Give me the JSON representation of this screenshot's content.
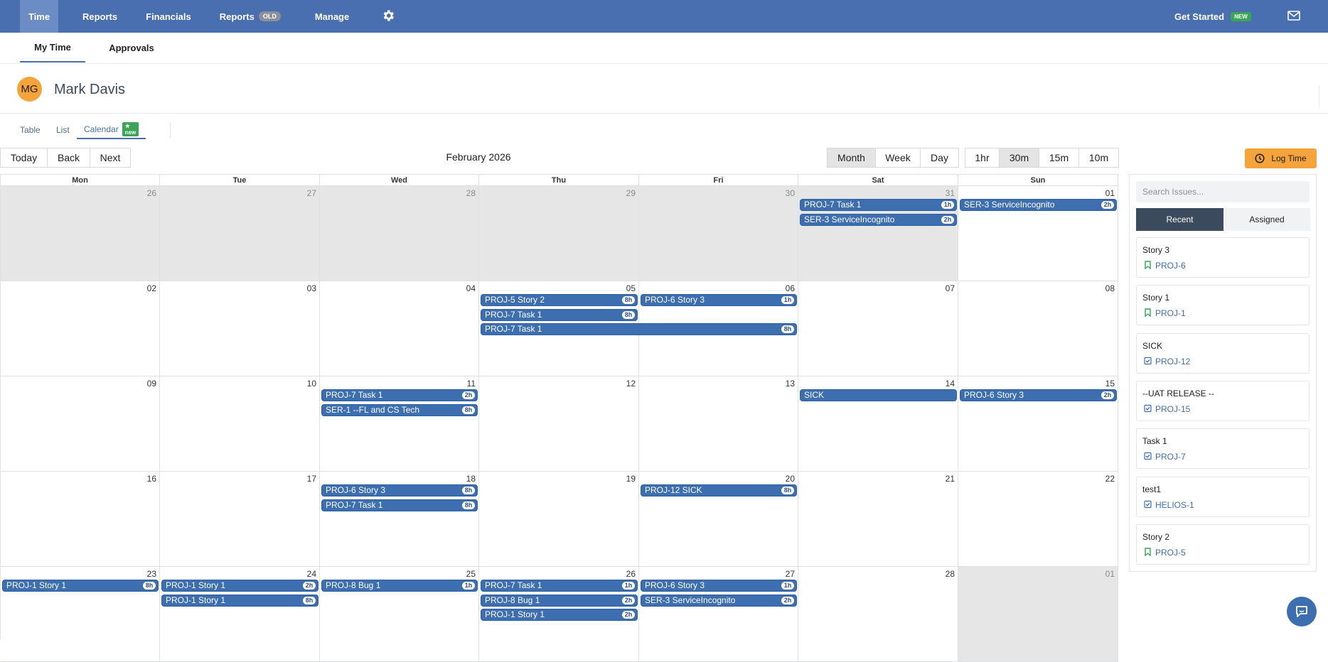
{
  "nav": {
    "items": [
      "Time",
      "Reports",
      "Financials",
      "Reports",
      "Manage"
    ],
    "old_badge": "OLD",
    "get_started": "Get Started",
    "new_badge": "NEW"
  },
  "subtabs": [
    "My Time",
    "Approvals"
  ],
  "user": {
    "initials": "MG",
    "name": "Mark Davis"
  },
  "views": {
    "table": "Table",
    "list": "List",
    "calendar": "Calendar",
    "new_badge": "★ new"
  },
  "toolbar": {
    "today": "Today",
    "back": "Back",
    "next": "Next",
    "title": "February 2026",
    "views": [
      "Month",
      "Week",
      "Day"
    ],
    "selected_view": "Month",
    "steps": [
      "1hr",
      "30m",
      "15m",
      "10m"
    ],
    "selected_step": "30m",
    "log_time": "Log Time"
  },
  "calendar": {
    "day_headers": [
      "Mon",
      "Tue",
      "Wed",
      "Thu",
      "Fri",
      "Sat",
      "Sun"
    ],
    "weeks": [
      [
        "26",
        "27",
        "28",
        "29",
        "30",
        "31",
        "01"
      ],
      [
        "02",
        "03",
        "04",
        "05",
        "06",
        "07",
        "08"
      ],
      [
        "09",
        "10",
        "11",
        "12",
        "13",
        "14",
        "15"
      ],
      [
        "16",
        "17",
        "18",
        "19",
        "20",
        "21",
        "22"
      ],
      [
        "23",
        "24",
        "25",
        "26",
        "27",
        "28",
        "01"
      ]
    ],
    "out_of_month": [
      [
        0,
        0
      ],
      [
        0,
        1
      ],
      [
        0,
        2
      ],
      [
        0,
        3
      ],
      [
        0,
        4
      ],
      [
        0,
        5
      ],
      [
        4,
        6
      ]
    ],
    "events": [
      {
        "label": "PROJ-7 Task 1",
        "hours": "1h",
        "week": 0,
        "day": 5,
        "span": 1,
        "slot": 0
      },
      {
        "label": "SER-3 ServiceIncognito",
        "hours": "2h",
        "week": 0,
        "day": 5,
        "span": 1,
        "slot": 1
      },
      {
        "label": "SER-3 ServiceIncognito",
        "hours": "2h",
        "week": 0,
        "day": 6,
        "span": 1,
        "slot": 0
      },
      {
        "label": "PROJ-5 Story 2",
        "hours": "8h",
        "week": 1,
        "day": 3,
        "span": 1,
        "slot": 0
      },
      {
        "label": "PROJ-7 Task 1",
        "hours": "8h",
        "week": 1,
        "day": 3,
        "span": 1,
        "slot": 1
      },
      {
        "label": "PROJ-7 Task 1",
        "hours": "8h",
        "week": 1,
        "day": 3,
        "span": 2,
        "slot": 2
      },
      {
        "label": "PROJ-6 Story 3",
        "hours": "1h",
        "week": 1,
        "day": 4,
        "span": 1,
        "slot": 0
      },
      {
        "label": "PROJ-7 Task 1",
        "hours": "2h",
        "week": 2,
        "day": 2,
        "span": 1,
        "slot": 0
      },
      {
        "label": "SER-1 --FL and CS Tech",
        "hours": "8h",
        "week": 2,
        "day": 2,
        "span": 1,
        "slot": 1
      },
      {
        "label": "SICK",
        "hours": "",
        "week": 2,
        "day": 5,
        "span": 1,
        "slot": 0
      },
      {
        "label": "PROJ-6 Story 3",
        "hours": "2h",
        "week": 2,
        "day": 6,
        "span": 1,
        "slot": 0
      },
      {
        "label": "PROJ-6 Story 3",
        "hours": "8h",
        "week": 3,
        "day": 2,
        "span": 1,
        "slot": 0
      },
      {
        "label": "PROJ-7 Task 1",
        "hours": "8h",
        "week": 3,
        "day": 2,
        "span": 1,
        "slot": 1
      },
      {
        "label": "PROJ-12 SICK",
        "hours": "8h",
        "week": 3,
        "day": 4,
        "span": 1,
        "slot": 0
      },
      {
        "label": "PROJ-1 Story 1",
        "hours": "8h",
        "week": 4,
        "day": 0,
        "span": 1,
        "slot": 0
      },
      {
        "label": "PROJ-1 Story 1",
        "hours": "2h",
        "week": 4,
        "day": 1,
        "span": 1,
        "slot": 0
      },
      {
        "label": "PROJ-1 Story 1",
        "hours": "8h",
        "week": 4,
        "day": 1,
        "span": 1,
        "slot": 1
      },
      {
        "label": "PROJ-8 Bug 1",
        "hours": "1h",
        "week": 4,
        "day": 2,
        "span": 1,
        "slot": 0
      },
      {
        "label": "PROJ-7 Task 1",
        "hours": "1h",
        "week": 4,
        "day": 3,
        "span": 1,
        "slot": 0
      },
      {
        "label": "PROJ-8 Bug 1",
        "hours": "2h",
        "week": 4,
        "day": 3,
        "span": 1,
        "slot": 1
      },
      {
        "label": "PROJ-1 Story 1",
        "hours": "2h",
        "week": 4,
        "day": 3,
        "span": 1,
        "slot": 2
      },
      {
        "label": "PROJ-6 Story 3",
        "hours": "1h",
        "week": 4,
        "day": 4,
        "span": 1,
        "slot": 0
      },
      {
        "label": "SER-3 ServiceIncognito",
        "hours": "2h",
        "week": 4,
        "day": 4,
        "span": 1,
        "slot": 1
      }
    ]
  },
  "panel": {
    "search_placeholder": "Search Issues...",
    "tabs": [
      "Recent",
      "Assigned"
    ],
    "issues": [
      {
        "title": "Story 3",
        "key": "PROJ-6",
        "icon": "bookmark-icon"
      },
      {
        "title": "Story 1",
        "key": "PROJ-1",
        "icon": "bookmark-icon"
      },
      {
        "title": "SICK",
        "key": "PROJ-12",
        "icon": "checkbox-icon"
      },
      {
        "title": "--UAT RELEASE --",
        "key": "PROJ-15",
        "icon": "checkbox-icon"
      },
      {
        "title": "Task 1",
        "key": "PROJ-7",
        "icon": "checkbox-icon"
      },
      {
        "title": "test1",
        "key": "HELIOS-1",
        "icon": "checkbox-icon"
      },
      {
        "title": "Story 2",
        "key": "PROJ-5",
        "icon": "bookmark-icon"
      }
    ]
  },
  "colors": {
    "nav": "#4a6fb0",
    "event": "#3d6eb0",
    "accent_orange": "#f5a33b",
    "story_icon": "#3aa457",
    "task_icon": "#3d6eb0"
  }
}
